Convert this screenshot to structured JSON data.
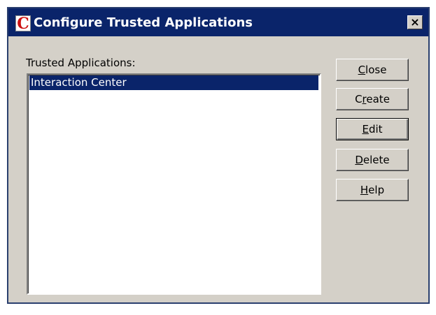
{
  "window": {
    "title": "Configure Trusted Applications",
    "app_icon_letter": "C",
    "close_glyph": "×"
  },
  "list": {
    "label": "Trusted Applications:",
    "items": [
      "Interaction Center"
    ],
    "selected_index": 0
  },
  "buttons": {
    "close": {
      "pre": "",
      "mnemonic": "C",
      "post": "lose"
    },
    "create": {
      "pre": "C",
      "mnemonic": "r",
      "post": "eate"
    },
    "edit": {
      "pre": "",
      "mnemonic": "E",
      "post": "dit"
    },
    "delete": {
      "pre": "",
      "mnemonic": "D",
      "post": "elete"
    },
    "help": {
      "pre": "",
      "mnemonic": "H",
      "post": "elp"
    }
  },
  "colors": {
    "titlebar": "#0a246a",
    "selection": "#0a246a",
    "dialog_face": "#d4d0c8",
    "icon_letter": "#cc1111"
  },
  "icons": [
    "app-logo-icon",
    "close-icon"
  ]
}
